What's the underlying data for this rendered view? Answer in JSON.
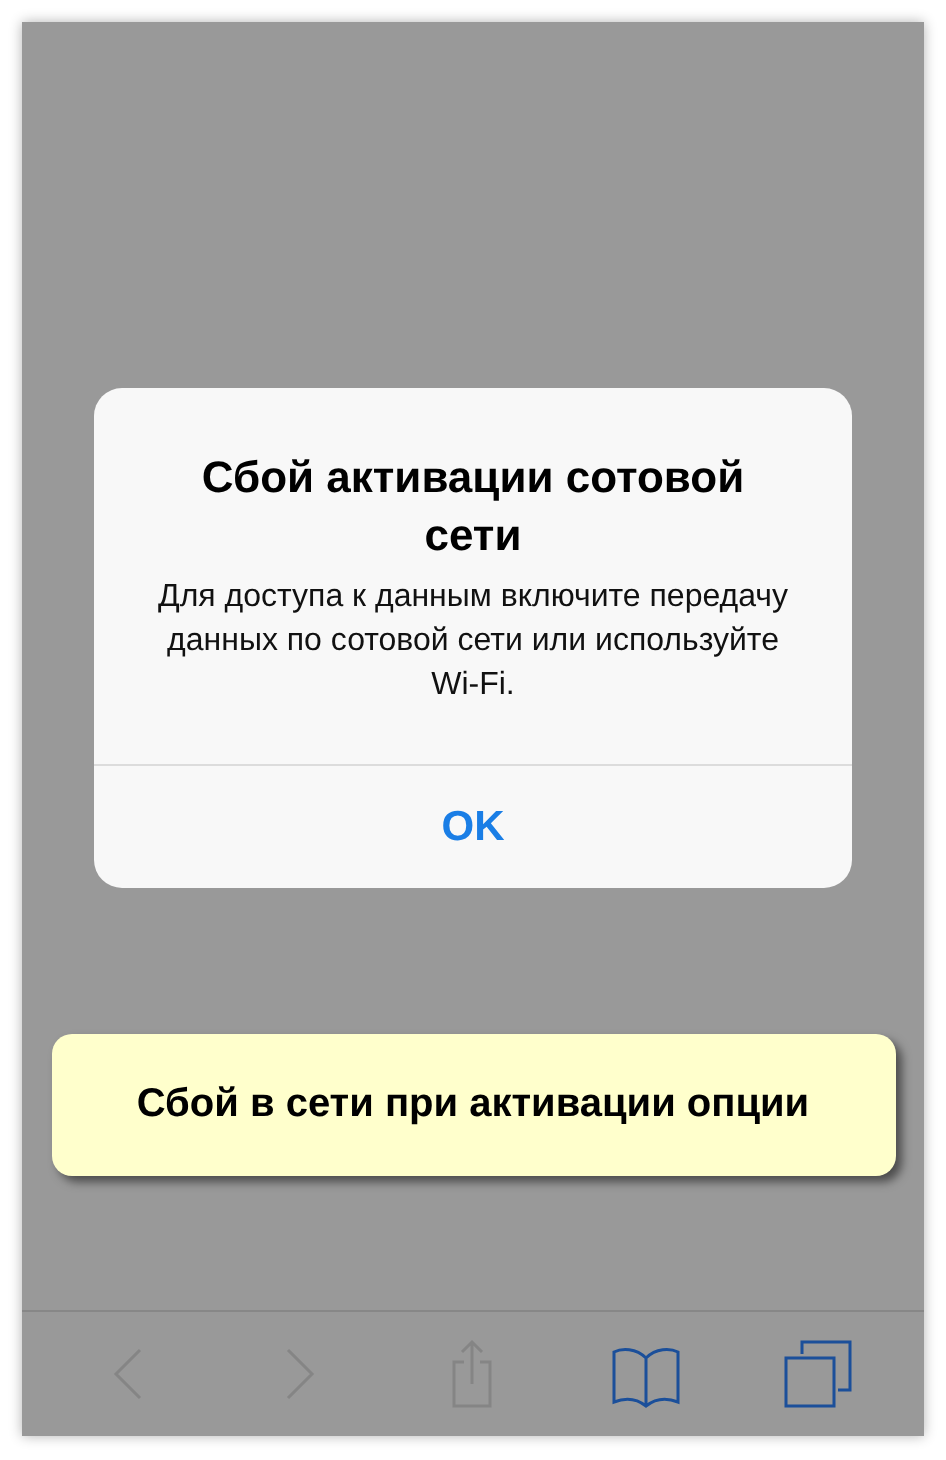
{
  "alert": {
    "title": "Сбой активации сотовой сети",
    "message": "Для доступа к данным включите передачу данных по сотовой сети или используйте Wi-Fi.",
    "button": "OK"
  },
  "callout": {
    "text": "Сбой в сети при активации опции"
  },
  "toolbar": [
    {
      "kind": "back",
      "disabled": true
    },
    {
      "kind": "forward",
      "disabled": true
    },
    {
      "kind": "share",
      "disabled": true
    },
    {
      "kind": "bookmarks",
      "disabled": false
    },
    {
      "kind": "tabs",
      "disabled": false
    }
  ]
}
